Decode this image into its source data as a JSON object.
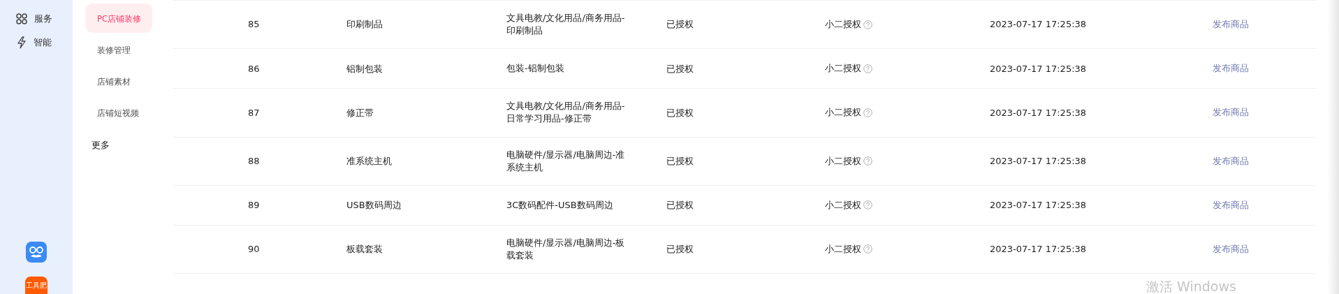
{
  "rail": {
    "items": [
      {
        "kind": "grid",
        "label": "服务"
      },
      {
        "kind": "bolt",
        "label": "智能"
      }
    ],
    "apps": [
      {
        "kind": "glasses"
      },
      {
        "kind": "badge",
        "label": "工具肥"
      }
    ]
  },
  "subnav": {
    "items": [
      {
        "label": "PC店铺装修",
        "selected": true
      },
      {
        "label": "装修管理",
        "selected": false
      },
      {
        "label": "店铺素材",
        "selected": false
      },
      {
        "label": "店铺短视频",
        "selected": false
      }
    ],
    "more": "更多"
  },
  "table": {
    "rows": [
      {
        "id": "85",
        "name": "印刷制品",
        "category": "文具电教/文化用品/商务用品-印刷制品",
        "status": "已授权",
        "auth": "小二授权",
        "time": "2023-07-17 17:25:38",
        "action": "发布商品"
      },
      {
        "id": "86",
        "name": "铝制包装",
        "category": "包装-铝制包装",
        "status": "已授权",
        "auth": "小二授权",
        "time": "2023-07-17 17:25:38",
        "action": "发布商品"
      },
      {
        "id": "87",
        "name": "修正带",
        "category": "文具电教/文化用品/商务用品-日常学习用品-修正带",
        "status": "已授权",
        "auth": "小二授权",
        "time": "2023-07-17 17:25:38",
        "action": "发布商品"
      },
      {
        "id": "88",
        "name": "准系统主机",
        "category": "电脑硬件/显示器/电脑周边-准系统主机",
        "status": "已授权",
        "auth": "小二授权",
        "time": "2023-07-17 17:25:38",
        "action": "发布商品"
      },
      {
        "id": "89",
        "name": "USB数码周边",
        "category": "3C数码配件-USB数码周边",
        "status": "已授权",
        "auth": "小二授权",
        "time": "2023-07-17 17:25:38",
        "action": "发布商品"
      },
      {
        "id": "90",
        "name": "板载套装",
        "category": "电脑硬件/显示器/电脑周边-板载套装",
        "status": "已授权",
        "auth": "小二授权",
        "time": "2023-07-17 17:25:38",
        "action": "发布商品"
      }
    ]
  },
  "os_notice": "激活 Windows"
}
